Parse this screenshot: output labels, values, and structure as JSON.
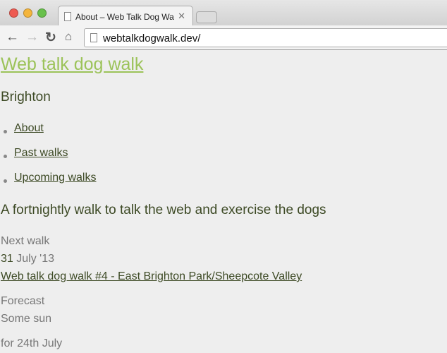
{
  "browser": {
    "tab_title": "About – Web Talk Dog Walk",
    "url": "webtalkdogwalk.dev/"
  },
  "page": {
    "site_title": "Web talk dog walk",
    "location": "Brighton",
    "nav": [
      {
        "label": "About"
      },
      {
        "label": "Past walks"
      },
      {
        "label": "Upcoming walks"
      }
    ],
    "tagline": "A fortnightly walk to talk the web and exercise the dogs",
    "next_walk": {
      "label": "Next walk",
      "day": "31",
      "date_rest": " July '13",
      "link": "Web talk dog walk #4 - East Brighton Park/Sheepcote Valley"
    },
    "forecast": {
      "label": "Forecast",
      "summary": "Some sun",
      "for_date": "for 24th July"
    }
  },
  "colors": {
    "title": "#9cc35a",
    "text": "#3d4a25",
    "muted": "#777777"
  }
}
